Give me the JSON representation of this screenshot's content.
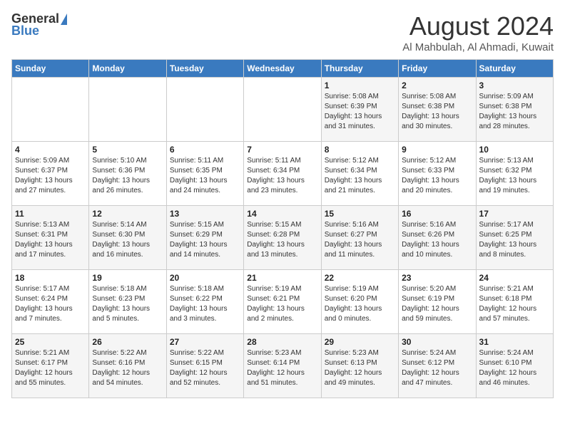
{
  "logo": {
    "general": "General",
    "blue": "Blue"
  },
  "title": {
    "month_year": "August 2024",
    "location": "Al Mahbulah, Al Ahmadi, Kuwait"
  },
  "days_of_week": [
    "Sunday",
    "Monday",
    "Tuesday",
    "Wednesday",
    "Thursday",
    "Friday",
    "Saturday"
  ],
  "weeks": [
    [
      {
        "day": "",
        "sunrise": "",
        "sunset": "",
        "daylight": ""
      },
      {
        "day": "",
        "sunrise": "",
        "sunset": "",
        "daylight": ""
      },
      {
        "day": "",
        "sunrise": "",
        "sunset": "",
        "daylight": ""
      },
      {
        "day": "",
        "sunrise": "",
        "sunset": "",
        "daylight": ""
      },
      {
        "day": "1",
        "sunrise": "Sunrise: 5:08 AM",
        "sunset": "Sunset: 6:39 PM",
        "daylight": "Daylight: 13 hours and 31 minutes."
      },
      {
        "day": "2",
        "sunrise": "Sunrise: 5:08 AM",
        "sunset": "Sunset: 6:38 PM",
        "daylight": "Daylight: 13 hours and 30 minutes."
      },
      {
        "day": "3",
        "sunrise": "Sunrise: 5:09 AM",
        "sunset": "Sunset: 6:38 PM",
        "daylight": "Daylight: 13 hours and 28 minutes."
      }
    ],
    [
      {
        "day": "4",
        "sunrise": "Sunrise: 5:09 AM",
        "sunset": "Sunset: 6:37 PM",
        "daylight": "Daylight: 13 hours and 27 minutes."
      },
      {
        "day": "5",
        "sunrise": "Sunrise: 5:10 AM",
        "sunset": "Sunset: 6:36 PM",
        "daylight": "Daylight: 13 hours and 26 minutes."
      },
      {
        "day": "6",
        "sunrise": "Sunrise: 5:11 AM",
        "sunset": "Sunset: 6:35 PM",
        "daylight": "Daylight: 13 hours and 24 minutes."
      },
      {
        "day": "7",
        "sunrise": "Sunrise: 5:11 AM",
        "sunset": "Sunset: 6:34 PM",
        "daylight": "Daylight: 13 hours and 23 minutes."
      },
      {
        "day": "8",
        "sunrise": "Sunrise: 5:12 AM",
        "sunset": "Sunset: 6:34 PM",
        "daylight": "Daylight: 13 hours and 21 minutes."
      },
      {
        "day": "9",
        "sunrise": "Sunrise: 5:12 AM",
        "sunset": "Sunset: 6:33 PM",
        "daylight": "Daylight: 13 hours and 20 minutes."
      },
      {
        "day": "10",
        "sunrise": "Sunrise: 5:13 AM",
        "sunset": "Sunset: 6:32 PM",
        "daylight": "Daylight: 13 hours and 19 minutes."
      }
    ],
    [
      {
        "day": "11",
        "sunrise": "Sunrise: 5:13 AM",
        "sunset": "Sunset: 6:31 PM",
        "daylight": "Daylight: 13 hours and 17 minutes."
      },
      {
        "day": "12",
        "sunrise": "Sunrise: 5:14 AM",
        "sunset": "Sunset: 6:30 PM",
        "daylight": "Daylight: 13 hours and 16 minutes."
      },
      {
        "day": "13",
        "sunrise": "Sunrise: 5:15 AM",
        "sunset": "Sunset: 6:29 PM",
        "daylight": "Daylight: 13 hours and 14 minutes."
      },
      {
        "day": "14",
        "sunrise": "Sunrise: 5:15 AM",
        "sunset": "Sunset: 6:28 PM",
        "daylight": "Daylight: 13 hours and 13 minutes."
      },
      {
        "day": "15",
        "sunrise": "Sunrise: 5:16 AM",
        "sunset": "Sunset: 6:27 PM",
        "daylight": "Daylight: 13 hours and 11 minutes."
      },
      {
        "day": "16",
        "sunrise": "Sunrise: 5:16 AM",
        "sunset": "Sunset: 6:26 PM",
        "daylight": "Daylight: 13 hours and 10 minutes."
      },
      {
        "day": "17",
        "sunrise": "Sunrise: 5:17 AM",
        "sunset": "Sunset: 6:25 PM",
        "daylight": "Daylight: 13 hours and 8 minutes."
      }
    ],
    [
      {
        "day": "18",
        "sunrise": "Sunrise: 5:17 AM",
        "sunset": "Sunset: 6:24 PM",
        "daylight": "Daylight: 13 hours and 7 minutes."
      },
      {
        "day": "19",
        "sunrise": "Sunrise: 5:18 AM",
        "sunset": "Sunset: 6:23 PM",
        "daylight": "Daylight: 13 hours and 5 minutes."
      },
      {
        "day": "20",
        "sunrise": "Sunrise: 5:18 AM",
        "sunset": "Sunset: 6:22 PM",
        "daylight": "Daylight: 13 hours and 3 minutes."
      },
      {
        "day": "21",
        "sunrise": "Sunrise: 5:19 AM",
        "sunset": "Sunset: 6:21 PM",
        "daylight": "Daylight: 13 hours and 2 minutes."
      },
      {
        "day": "22",
        "sunrise": "Sunrise: 5:19 AM",
        "sunset": "Sunset: 6:20 PM",
        "daylight": "Daylight: 13 hours and 0 minutes."
      },
      {
        "day": "23",
        "sunrise": "Sunrise: 5:20 AM",
        "sunset": "Sunset: 6:19 PM",
        "daylight": "Daylight: 12 hours and 59 minutes."
      },
      {
        "day": "24",
        "sunrise": "Sunrise: 5:21 AM",
        "sunset": "Sunset: 6:18 PM",
        "daylight": "Daylight: 12 hours and 57 minutes."
      }
    ],
    [
      {
        "day": "25",
        "sunrise": "Sunrise: 5:21 AM",
        "sunset": "Sunset: 6:17 PM",
        "daylight": "Daylight: 12 hours and 55 minutes."
      },
      {
        "day": "26",
        "sunrise": "Sunrise: 5:22 AM",
        "sunset": "Sunset: 6:16 PM",
        "daylight": "Daylight: 12 hours and 54 minutes."
      },
      {
        "day": "27",
        "sunrise": "Sunrise: 5:22 AM",
        "sunset": "Sunset: 6:15 PM",
        "daylight": "Daylight: 12 hours and 52 minutes."
      },
      {
        "day": "28",
        "sunrise": "Sunrise: 5:23 AM",
        "sunset": "Sunset: 6:14 PM",
        "daylight": "Daylight: 12 hours and 51 minutes."
      },
      {
        "day": "29",
        "sunrise": "Sunrise: 5:23 AM",
        "sunset": "Sunset: 6:13 PM",
        "daylight": "Daylight: 12 hours and 49 minutes."
      },
      {
        "day": "30",
        "sunrise": "Sunrise: 5:24 AM",
        "sunset": "Sunset: 6:12 PM",
        "daylight": "Daylight: 12 hours and 47 minutes."
      },
      {
        "day": "31",
        "sunrise": "Sunrise: 5:24 AM",
        "sunset": "Sunset: 6:10 PM",
        "daylight": "Daylight: 12 hours and 46 minutes."
      }
    ]
  ]
}
